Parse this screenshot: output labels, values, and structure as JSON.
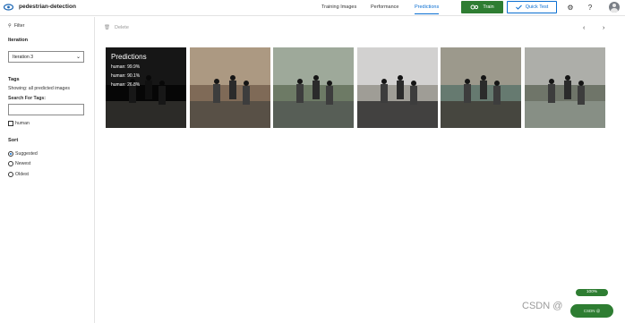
{
  "header": {
    "project_name": "pedestrian-detection",
    "tabs": [
      "Training Images",
      "Performance",
      "Predictions"
    ],
    "active_tab": "Predictions",
    "train_label": "Train",
    "quick_test_label": "Quick Test"
  },
  "sidebar": {
    "filter_label": "Filter",
    "iteration_heading": "Iteration",
    "iteration_value": "Iteration 3",
    "tags_heading": "Tags",
    "showing_text": "Showing: all predicted images",
    "search_tags_label": "Search For Tags:",
    "search_tags_value": "",
    "tag_options": [
      "human"
    ],
    "sort_heading": "Sort",
    "sort_options": [
      "Suggested",
      "Newest",
      "Oldest"
    ],
    "selected_sort": "Suggested"
  },
  "toolbar": {
    "delete_label": "Delete"
  },
  "predictions_overlay": {
    "title": "Predictions",
    "items": [
      "human: 99.9%",
      "human: 90.1%",
      "human: 26.8%"
    ]
  },
  "images": [
    {
      "colors": [
        "#121212",
        "#444",
        "#8e8a82"
      ]
    },
    {
      "colors": [
        "#7f6a57",
        "#b4a18a",
        "#4f4a42"
      ]
    },
    {
      "colors": [
        "#6d7a65",
        "#a7b1a3",
        "#515853"
      ]
    },
    {
      "colors": [
        "#9f9d96",
        "#dadada",
        "#2a2a2a"
      ]
    },
    {
      "colors": [
        "#667a70",
        "#a69f90",
        "#3e3a33"
      ]
    },
    {
      "colors": [
        "#6f7569",
        "#b8b9b5",
        "#8d968c"
      ]
    }
  ],
  "status": {
    "progress_label": "100%",
    "progress_value": 1.0,
    "fab_label": "CSDN @"
  },
  "watermark_text": "CSDN @"
}
